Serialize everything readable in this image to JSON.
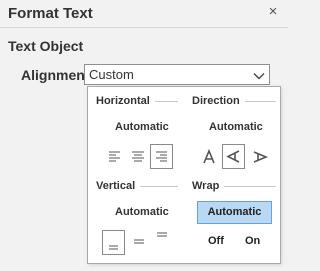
{
  "header": {
    "title": "Format Text",
    "close_icon": "close-icon",
    "close_glyph": "×"
  },
  "section": {
    "title": "Text Object"
  },
  "alignment": {
    "label": "Alignment:",
    "value": "Custom",
    "chevron_icon": "chevron-down-icon"
  },
  "popup": {
    "horizontal": {
      "label": "Horizontal",
      "value": "Automatic",
      "options": [
        "align-left-icon",
        "align-center-icon",
        "align-right-icon"
      ],
      "selected": "align-right-icon"
    },
    "direction": {
      "label": "Direction",
      "value": "Automatic",
      "options": [
        "text-up-icon",
        "text-left-icon",
        "text-down-icon"
      ],
      "selected": "text-left-icon"
    },
    "vertical": {
      "label": "Vertical",
      "value": "Automatic",
      "options": [
        "align-bottom-icon",
        "align-middle-icon",
        "align-top-icon"
      ],
      "selected": "align-bottom-icon"
    },
    "wrap": {
      "label": "Wrap",
      "value": "Automatic",
      "off_label": "Off",
      "on_label": "On"
    }
  },
  "colors": {
    "accent_bg": "#b9d8f3",
    "accent_border": "#6aa3d3",
    "panel_bg": "#f2f2f2"
  }
}
